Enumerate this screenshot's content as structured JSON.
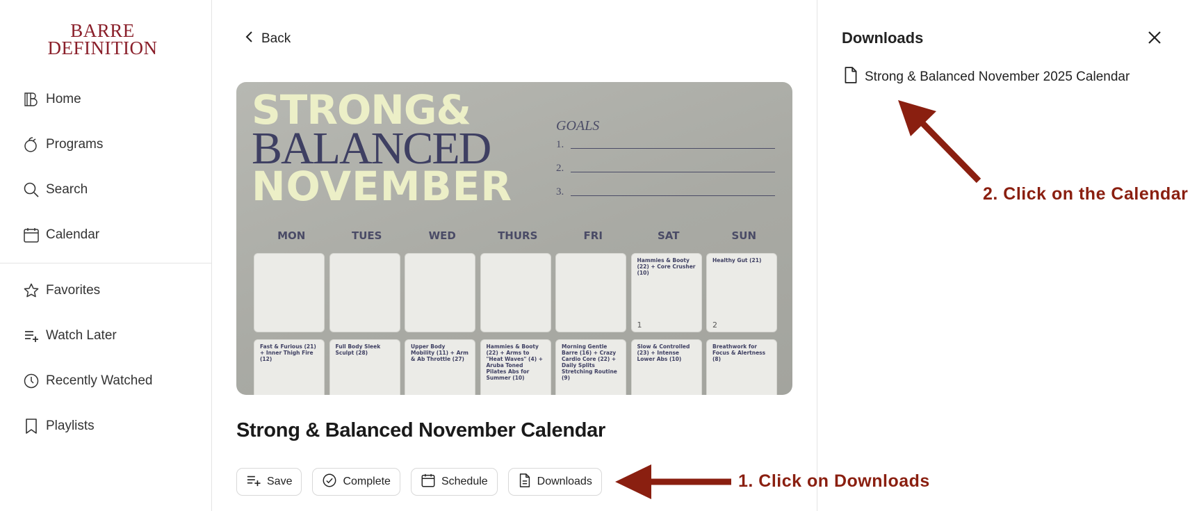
{
  "sidebar": {
    "logo_line1": "BARRE",
    "logo_line2": "DEFINITION",
    "items": [
      {
        "label": "Home",
        "icon": "home-icon"
      },
      {
        "label": "Programs",
        "icon": "programs-icon"
      },
      {
        "label": "Search",
        "icon": "search-icon"
      },
      {
        "label": "Calendar",
        "icon": "calendar-icon"
      }
    ],
    "items2": [
      {
        "label": "Favorites",
        "icon": "star-icon"
      },
      {
        "label": "Watch Later",
        "icon": "playlist-add-icon"
      },
      {
        "label": "Recently Watched",
        "icon": "clock-icon"
      },
      {
        "label": "Playlists",
        "icon": "bookmark-icon"
      }
    ]
  },
  "main": {
    "back_label": "Back",
    "hero": {
      "title_strong": "STRONG&",
      "title_balanced": "BALANCED",
      "title_november": "NOVEMBER",
      "goals_title": "GOALS",
      "goals": [
        "1.",
        "2.",
        "3."
      ],
      "days": [
        "MON",
        "TUES",
        "WED",
        "THURS",
        "FRI",
        "SAT",
        "SUN"
      ],
      "row1": [
        {
          "text": "",
          "num": ""
        },
        {
          "text": "",
          "num": ""
        },
        {
          "text": "",
          "num": ""
        },
        {
          "text": "",
          "num": ""
        },
        {
          "text": "",
          "num": ""
        },
        {
          "text": "Hammies & Booty (22) + Core Crusher (10)",
          "num": "1"
        },
        {
          "text": "Healthy Gut (21)",
          "num": "2"
        }
      ],
      "row2": [
        {
          "text": "Fast & Furious (21) + Inner Thigh Fire (12)"
        },
        {
          "text": "Full Body Sleek Sculpt (28)"
        },
        {
          "text": "Upper Body Mobility (11) + Arm & Ab Throttle (27)"
        },
        {
          "text": "Hammies & Booty (22) + Arms to \"Heat Waves\" (4) + Aruba Toned Pilates Abs for Summer (10)"
        },
        {
          "text": "Morning Gentle Barre (16) + Crazy Cardio Core (22) + Daily Splits Stretching Routine (9)"
        },
        {
          "text": "Slow & Controlled (23) + Intense Lower Abs (10)"
        },
        {
          "text": "Breathwork for Focus & Alertness (8)"
        }
      ]
    },
    "title": "Strong & Balanced November Calendar",
    "actions": {
      "save": "Save",
      "complete": "Complete",
      "schedule": "Schedule",
      "downloads": "Downloads"
    }
  },
  "downloads_panel": {
    "title": "Downloads",
    "items": [
      {
        "label": "Strong & Balanced November 2025 Calendar",
        "icon": "file-icon"
      }
    ]
  },
  "annotations": {
    "step1": "1. Click on Downloads",
    "step2": "2. Click on the Calendar",
    "color": "#8a1f10"
  },
  "colors": {
    "brand": "#8a1f2a",
    "hero_cream": "#ecefc7",
    "hero_navy": "#3e3f62"
  }
}
